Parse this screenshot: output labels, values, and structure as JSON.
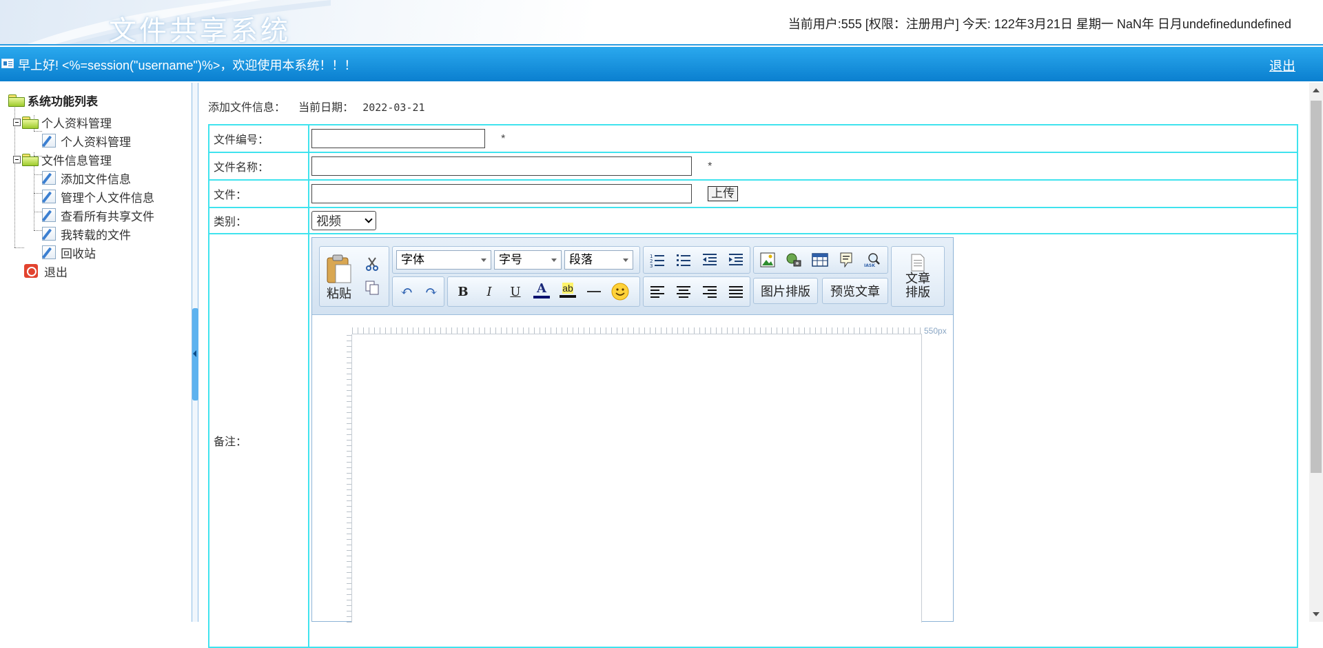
{
  "header": {
    "logo_text": "文件共享系统",
    "user_info": "当前用户:555 [权限：注册用户] 今天:   122年3月21日 星期一 NaN年 日月undefinedundefined"
  },
  "greeting": {
    "text": "早上好! <%=session(\"username\")%>，欢迎使用本系统！！！",
    "logout": "退出"
  },
  "sidebar": {
    "root": "系统功能列表",
    "groups": [
      {
        "label": "个人资料管理",
        "items": [
          "个人资料管理"
        ]
      },
      {
        "label": "文件信息管理",
        "items": [
          "添加文件信息",
          "管理个人文件信息",
          "查看所有共享文件",
          "我转载的文件",
          "回收站"
        ]
      }
    ],
    "exit": "退出"
  },
  "main": {
    "title": "添加文件信息：",
    "date_label": "当前日期：",
    "date_value": "2022-03-21",
    "form": {
      "file_no_label": "文件编号：",
      "file_name_label": "文件名称：",
      "file_label": "文件：",
      "category_label": "类别：",
      "remark_label": "备注：",
      "required_mark": "*",
      "upload_button": "上传",
      "file_no_value": "",
      "file_name_value": "",
      "file_value": "",
      "category_value": "视频"
    }
  },
  "editor": {
    "paste": "粘贴",
    "font_family": "字体",
    "font_size": "字号",
    "paragraph": "段落",
    "image_layout": "图片排版",
    "preview": "预览文章",
    "article_layout_1": "文章",
    "article_layout_2": "排版",
    "ruler_label": "550px",
    "bold": "B",
    "italic": "I",
    "underline": "U",
    "font_color": "A",
    "highlight": "ab"
  }
}
